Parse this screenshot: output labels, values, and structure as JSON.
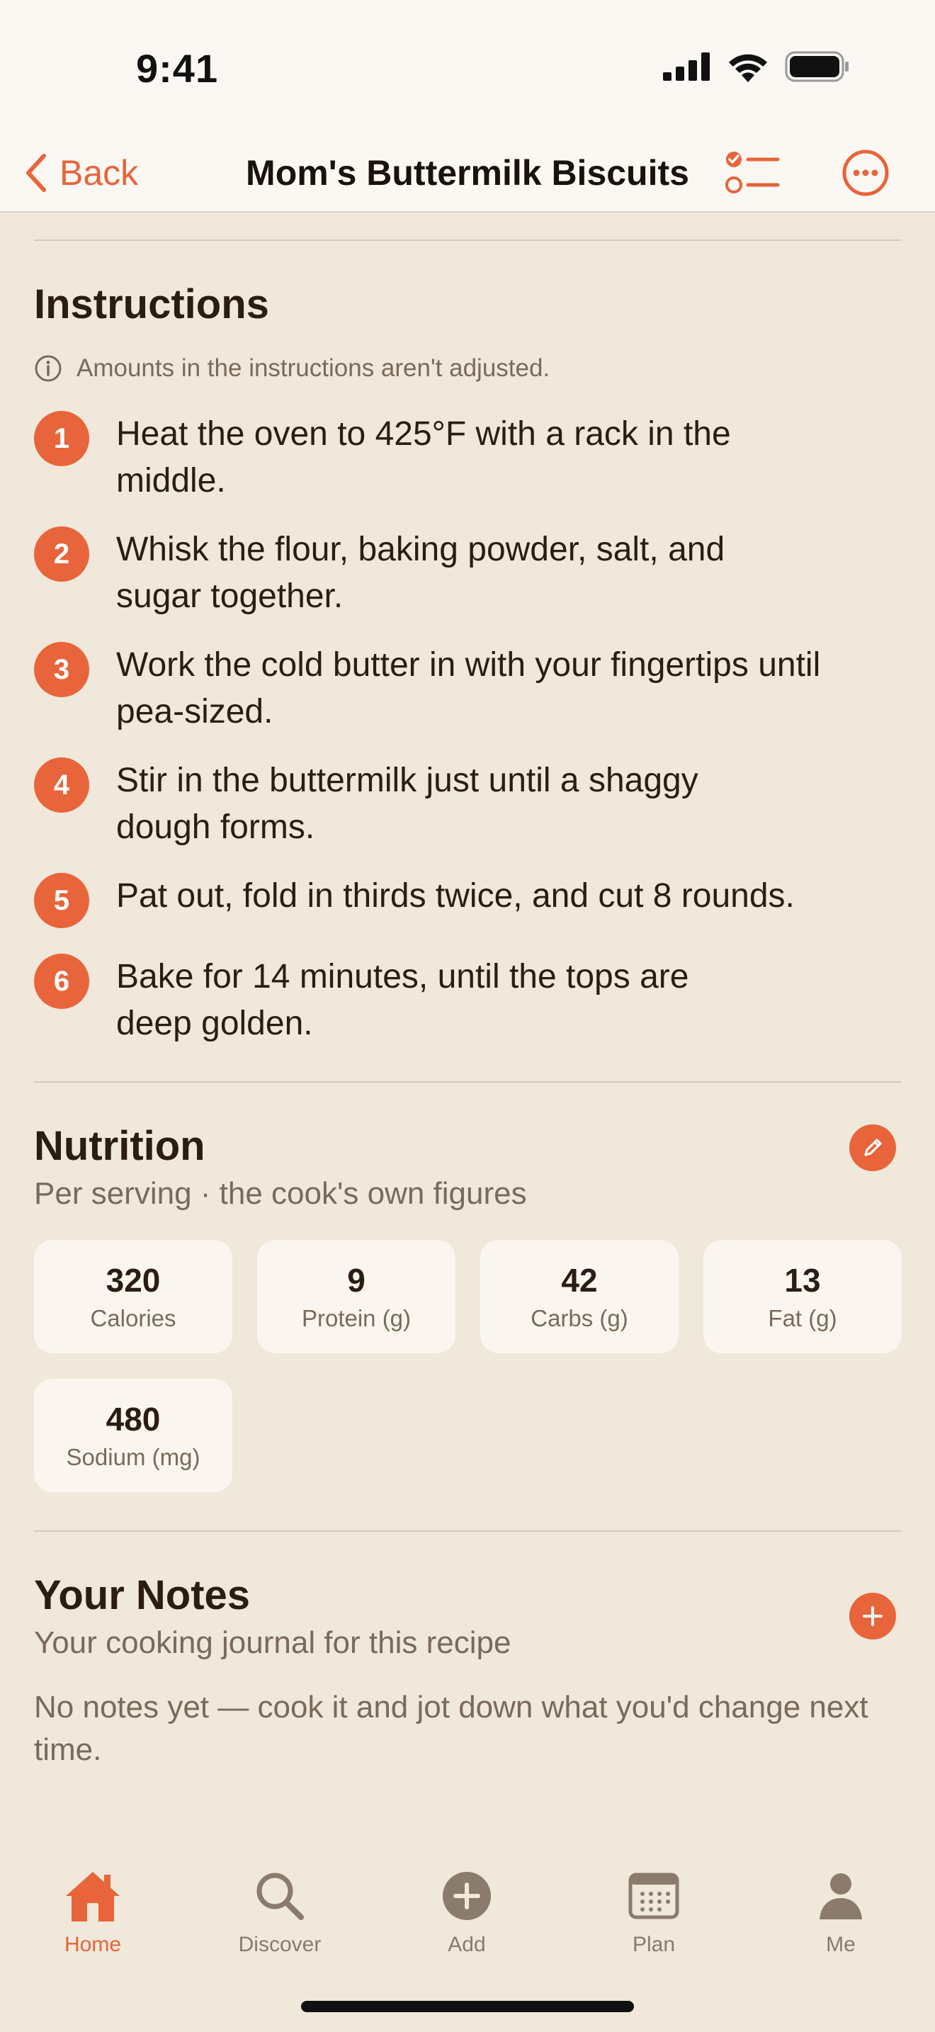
{
  "status": {
    "time": "9:41"
  },
  "nav": {
    "back_label": "Back",
    "title": "Mom's Buttermilk Biscuits"
  },
  "instructions": {
    "heading": "Instructions",
    "note": "Amounts in the instructions aren't adjusted.",
    "steps": [
      {
        "num": "1",
        "text": "Heat the oven to 425°F with a rack in the middle."
      },
      {
        "num": "2",
        "text": "Whisk the flour, baking powder, salt, and sugar together."
      },
      {
        "num": "3",
        "text": "Work the cold butter in with your fingertips until pea-sized."
      },
      {
        "num": "4",
        "text": "Stir in the buttermilk just until a shaggy dough forms."
      },
      {
        "num": "5",
        "text": "Pat out, fold in thirds twice, and cut 8 rounds."
      },
      {
        "num": "6",
        "text": "Bake for 14 minutes, until the tops are deep golden."
      }
    ]
  },
  "nutrition": {
    "heading": "Nutrition",
    "subtitle": "Per serving · the cook's own figures",
    "items": [
      {
        "value": "320",
        "label": "Calories"
      },
      {
        "value": "9",
        "label": "Protein (g)"
      },
      {
        "value": "42",
        "label": "Carbs (g)"
      },
      {
        "value": "13",
        "label": "Fat (g)"
      },
      {
        "value": "480",
        "label": "Sodium (mg)"
      }
    ]
  },
  "notes": {
    "heading": "Your Notes",
    "subtitle": "Your cooking journal for this recipe",
    "empty": "No notes yet — cook it and jot down what you'd change next time."
  },
  "tabs": [
    {
      "label": "Home",
      "icon": "house-icon",
      "active": true
    },
    {
      "label": "Discover",
      "icon": "magnifier-icon",
      "active": false
    },
    {
      "label": "Add",
      "icon": "plus-circle-icon",
      "active": false
    },
    {
      "label": "Plan",
      "icon": "calendar-icon",
      "active": false
    },
    {
      "label": "Me",
      "icon": "person-icon",
      "active": false
    }
  ],
  "colors": {
    "accent": "#e8643a",
    "background": "#f0e8da",
    "card": "#faf6ef",
    "muted": "#7a6a5c"
  }
}
